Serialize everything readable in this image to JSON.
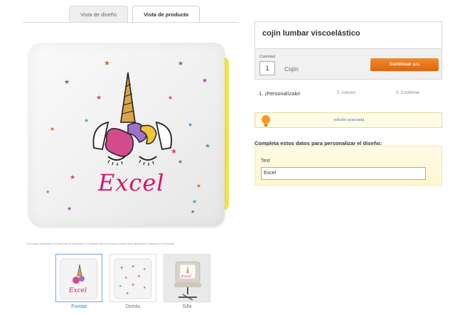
{
  "tabs": [
    {
      "label": "Vista de diseño"
    },
    {
      "label": "Vista de producto"
    }
  ],
  "product": {
    "name_text": "Excel",
    "disclaimer": "* La imagen mostrada en la vista real es orientativa, el resultado final del producto puede variar ligeramente respecto a la mostrada."
  },
  "thumbnails": [
    {
      "label": "Frontal",
      "selected": true
    },
    {
      "label": "Detrás",
      "selected": false
    },
    {
      "label": "Silla",
      "selected": false
    }
  ],
  "panel": {
    "title": "cojín lumbar viscoelástico",
    "quantity_label": "Cantidad",
    "quantity_value": "1",
    "quantity_unit": "Cojín",
    "continue_label": "Continuar",
    "continue_step": "(1/3)",
    "steps": [
      {
        "label": "1. ¡Personalízalo!"
      },
      {
        "label": "2. colores"
      },
      {
        "label": "3. Confirmar"
      }
    ],
    "advanced_link": "edición avanzada",
    "form_title": "Completa estos datos para personalizar el diseño:",
    "field_label": "Text",
    "field_value": "Excel"
  },
  "colors": {
    "accent_orange": "#e86f14",
    "link_blue": "#3b7fc4",
    "name_pink": "#d4166b",
    "horn_gold": "#c9953a"
  }
}
